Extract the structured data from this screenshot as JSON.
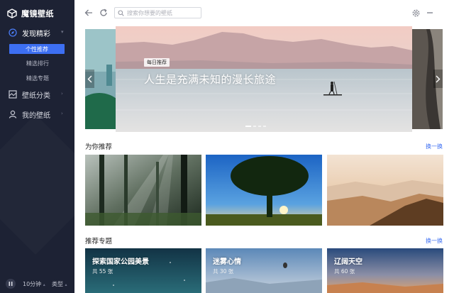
{
  "app": {
    "name": "魔镜壁纸"
  },
  "sidebar": {
    "discover": {
      "label": "发现精彩",
      "items": [
        "个性推荐",
        "精选排行",
        "精选专题"
      ]
    },
    "category": {
      "label": "壁纸分类"
    },
    "mine": {
      "label": "我的壁纸"
    },
    "bottom": {
      "interval": "10分钟",
      "type": "类型"
    }
  },
  "search": {
    "placeholder": "搜索你想要的壁纸"
  },
  "banner": {
    "tag": "每日推荐",
    "title": "人生是充满未知的漫长旅途",
    "slide_count": 4,
    "active_slide": 0
  },
  "recommend": {
    "title": "为你推荐",
    "more": "换一换",
    "cards": [
      {
        "name": "forest-sunbeams-thumbnail"
      },
      {
        "name": "lone-tree-sunset-thumbnail"
      },
      {
        "name": "misty-mountains-thumbnail"
      }
    ]
  },
  "topics": {
    "title": "推荐专题",
    "more": "换一换",
    "items": [
      {
        "title": "探索国家公园美景",
        "count": "共 55 张"
      },
      {
        "title": "迷雾心情",
        "count": "共 30 张"
      },
      {
        "title": "辽阔天空",
        "count": "共 60 张"
      }
    ]
  },
  "colors": {
    "sidebar_bg": "#1d2234",
    "accent": "#3d6ff2",
    "link": "#3d6ff2"
  },
  "icons": [
    "cube-logo-icon",
    "discover-icon",
    "category-icon",
    "user-icon",
    "pause-icon",
    "back-icon",
    "refresh-icon",
    "search-icon",
    "settings-icon",
    "minimize-icon"
  ]
}
